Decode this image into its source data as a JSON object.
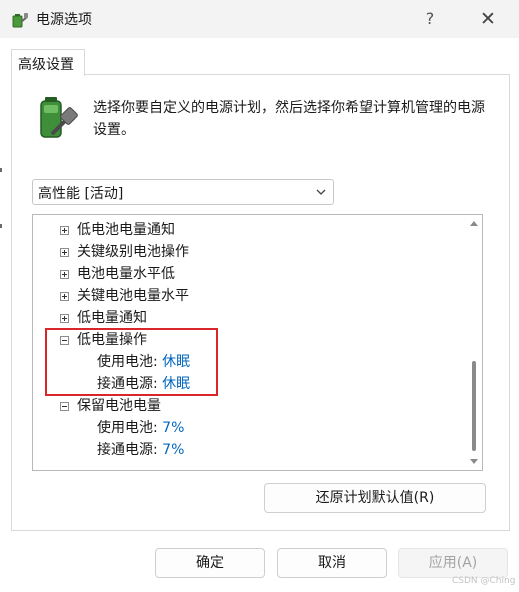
{
  "window": {
    "title": "电源选项",
    "help_glyph": "?",
    "close_glyph": "✕"
  },
  "tab": {
    "label": "高级设置"
  },
  "description": "选择你要自定义的电源计划，然后选择你希望计算机管理的电源设置。",
  "plan_select": {
    "value": "高性能 [活动]"
  },
  "tree": {
    "items": [
      {
        "label": "低电池电量通知",
        "expanded": false
      },
      {
        "label": "关键级别电池操作",
        "expanded": false
      },
      {
        "label": "电池电量水平低",
        "expanded": false
      },
      {
        "label": "关键电池电量水平",
        "expanded": false
      },
      {
        "label": "低电量通知",
        "expanded": false
      },
      {
        "label": "低电量操作",
        "expanded": true,
        "children": [
          {
            "label": "使用电池:",
            "value": "休眠"
          },
          {
            "label": "接通电源:",
            "value": "休眠"
          }
        ]
      },
      {
        "label": "保留电池电量",
        "expanded": true,
        "children": [
          {
            "label": "使用电池:",
            "value": "7%"
          },
          {
            "label": "接通电源:",
            "value": "7%"
          }
        ]
      }
    ]
  },
  "buttons": {
    "restore": "还原计划默认值(R)",
    "ok": "确定",
    "cancel": "取消",
    "apply": "应用(A)"
  },
  "watermark": "CSDN @Ching",
  "colors": {
    "value_text": "#0067c0",
    "highlight_box": "#d8262b",
    "titlebar": "#f3f3f3"
  }
}
